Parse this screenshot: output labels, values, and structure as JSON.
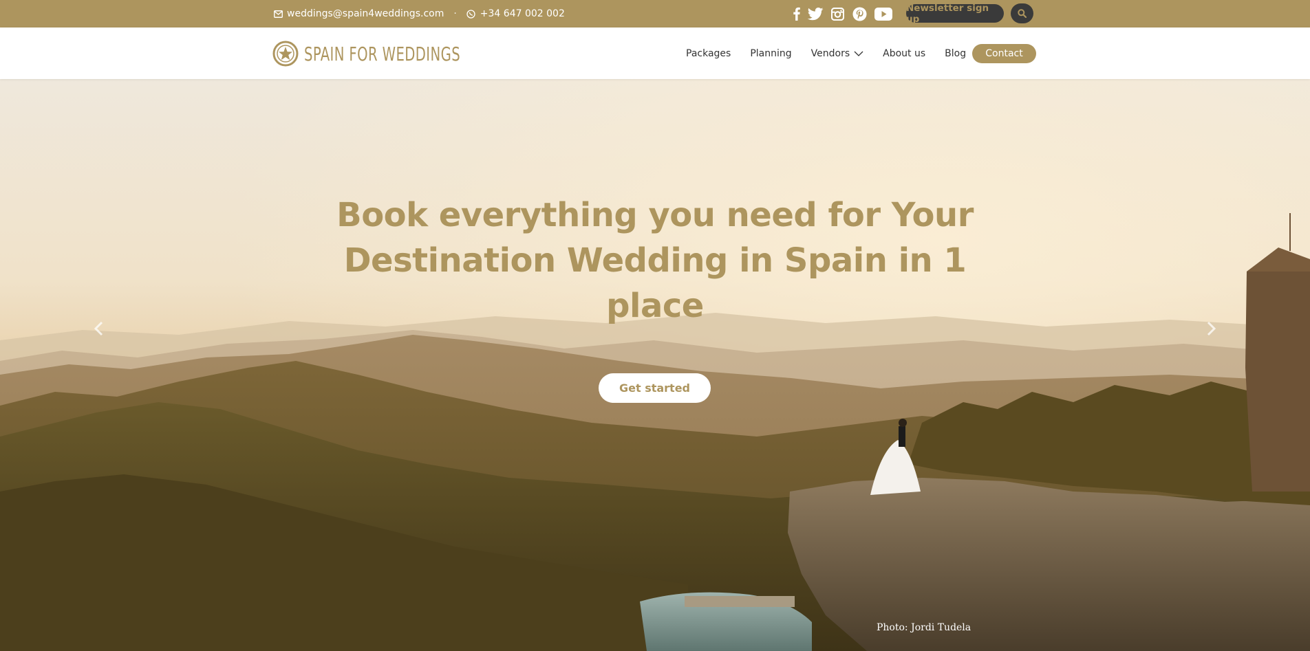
{
  "topbar": {
    "email": "weddings@spain4weddings.com",
    "separator": "·",
    "phone": "+34 647 002 002",
    "social_icons": [
      "facebook-icon",
      "twitter-icon",
      "instagram-icon",
      "pinterest-icon",
      "youtube-icon"
    ],
    "newsletter_label": "Newsletter sign up",
    "search_icon": "search-icon"
  },
  "header": {
    "logo_text": "SPAIN FOR WEDDINGS",
    "nav": [
      {
        "label": "Packages"
      },
      {
        "label": "Planning"
      },
      {
        "label": "Vendors",
        "has_dropdown": true
      },
      {
        "label": "About us"
      },
      {
        "label": "Blog"
      }
    ],
    "contact_label": "Contact"
  },
  "hero": {
    "title": "Book everything you need for Your Destination Wedding in Spain in 1 place",
    "cta_label": "Get started",
    "photo_credit": "Photo: Jordi Tudela",
    "prev_icon": "chevron-left-icon",
    "next_icon": "chevron-right-icon"
  },
  "colors": {
    "brand_gold": "#ad955e",
    "dark_button": "#3a3a3a",
    "nav_text": "#333333"
  }
}
